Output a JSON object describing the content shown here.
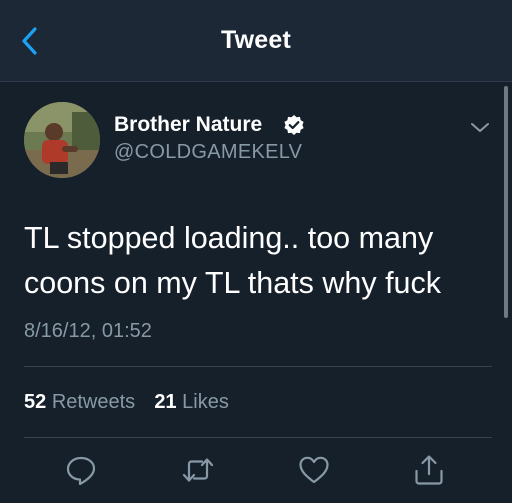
{
  "header": {
    "title": "Tweet",
    "back_icon": "chevron-left-icon",
    "accent_color": "#1da1f2"
  },
  "tweet": {
    "author_name": "Brother Nature",
    "author_handle": "@COLDGAMEKELV",
    "verified": true,
    "text_line1": "TL stopped loading.. too many",
    "text_line2": "coons on my TL thats why fuck",
    "timestamp": "8/16/12, 01:52"
  },
  "stats": {
    "retweets_count": "52",
    "retweets_label": "Retweets",
    "likes_count": "21",
    "likes_label": "Likes"
  },
  "actions": [
    "reply-icon",
    "retweet-icon",
    "like-icon",
    "share-icon"
  ],
  "colors": {
    "background": "#15202b",
    "header_bg": "#1c2836",
    "secondary_text": "#8899a6",
    "divider": "#38444d"
  }
}
